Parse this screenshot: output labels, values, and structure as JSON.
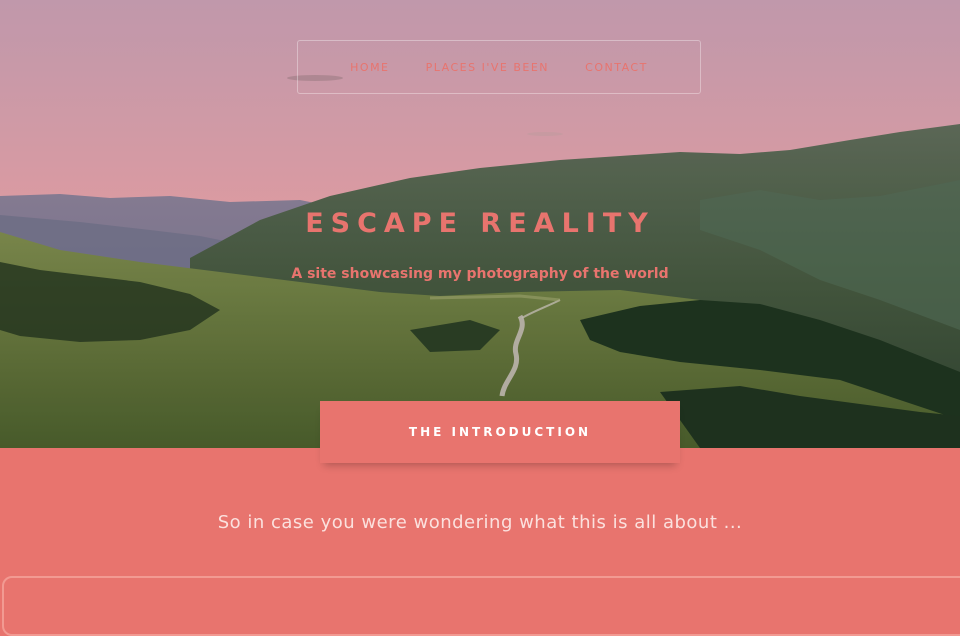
{
  "nav": {
    "items": [
      {
        "label": "HOME"
      },
      {
        "label": "PLACES I'VE BEEN"
      },
      {
        "label": "CONTACT"
      }
    ]
  },
  "hero": {
    "title": "ESCAPE REALITY",
    "subtitle": "A site showcasing my photography of the world"
  },
  "intro": {
    "tab_label": "THE INTRODUCTION",
    "text": "So in case you were wondering what this is all about ..."
  },
  "colors": {
    "accent": "#e8746e",
    "sky_top": "#c89fb2",
    "sky_horizon": "#f6a398"
  }
}
